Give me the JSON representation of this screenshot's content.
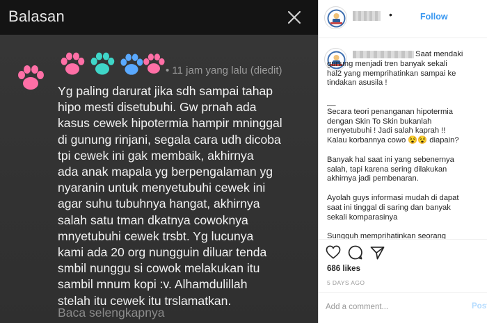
{
  "colors": {
    "pink_paw": "#ff6fa6",
    "teal_paw": "#3fd6c8",
    "blue_paw": "#5aa9ff",
    "follow": "#3897f0"
  },
  "left_panel": {
    "title": "Balasan",
    "close_icon": "close-icon",
    "comment": {
      "meta": "• 11 jam yang lalu (diedit)",
      "lines": [
        "Yg paling darurat jika sdh sampai tahap",
        "hipo mesti disetubuhi. Gw prnah ada",
        "kasus cewek hipotermia hampir mninggal",
        "di gunung rinjani, segala cara udh dicoba",
        "tpi cewek ini gak membaik, akhirnya",
        "ada anak mapala yg berpengalaman yg",
        "nyaranin untuk menyetubuhi cewek ini",
        "agar suhu tubuhnya hangat, akhirnya",
        "salah satu tman dkatnya cowoknya",
        "mnyetubuhi cewek trsbt. Yg lucunya",
        "kami ada 20 org nungguin diluar tenda",
        "smbil nunggu si cowok melakukan itu",
        "sambil mnum kopi :v. Alhamdulillah",
        "stelah itu cewek itu trslamatkan."
      ],
      "read_more": "Baca selengkapnya"
    }
  },
  "right_panel": {
    "header": {
      "separator": "•",
      "follow_label": "Follow"
    },
    "caption": {
      "paragraphs": [
        [
          "Saat mendaki",
          "gunung menjadi tren banyak sekali",
          "hal2 yang memprihatinkan sampai ke",
          "tindakan asusila !"
        ],
        [
          "__",
          "Secara teori penanganan hipotermia",
          "dengan Skin To Skin bukanlah",
          "menyetubuhi ! Jadi salah kaprah !!",
          "Kalau korbannya cowo 😵😵 diapain?"
        ],
        [
          "Banyak hal saat ini yang sebenernya",
          "salah, tapi karena sering dilakukan",
          "akhirnya jadi pembenaran."
        ],
        [
          "Ayolah guys informasi mudah di dapat",
          "saat ini tinggal di saring dan banyak",
          "sekali komparasinya"
        ],
        [
          "Sungguh memprihatinkan seorang"
        ]
      ]
    },
    "actions": {
      "like_icon": "heart-icon",
      "comment_icon": "comment-icon",
      "share_icon": "share-icon"
    },
    "likes": "686 likes",
    "date": "5 DAYS AGO",
    "comment_box": {
      "placeholder": "Add a comment...",
      "value": "",
      "post_label": "Post"
    }
  }
}
